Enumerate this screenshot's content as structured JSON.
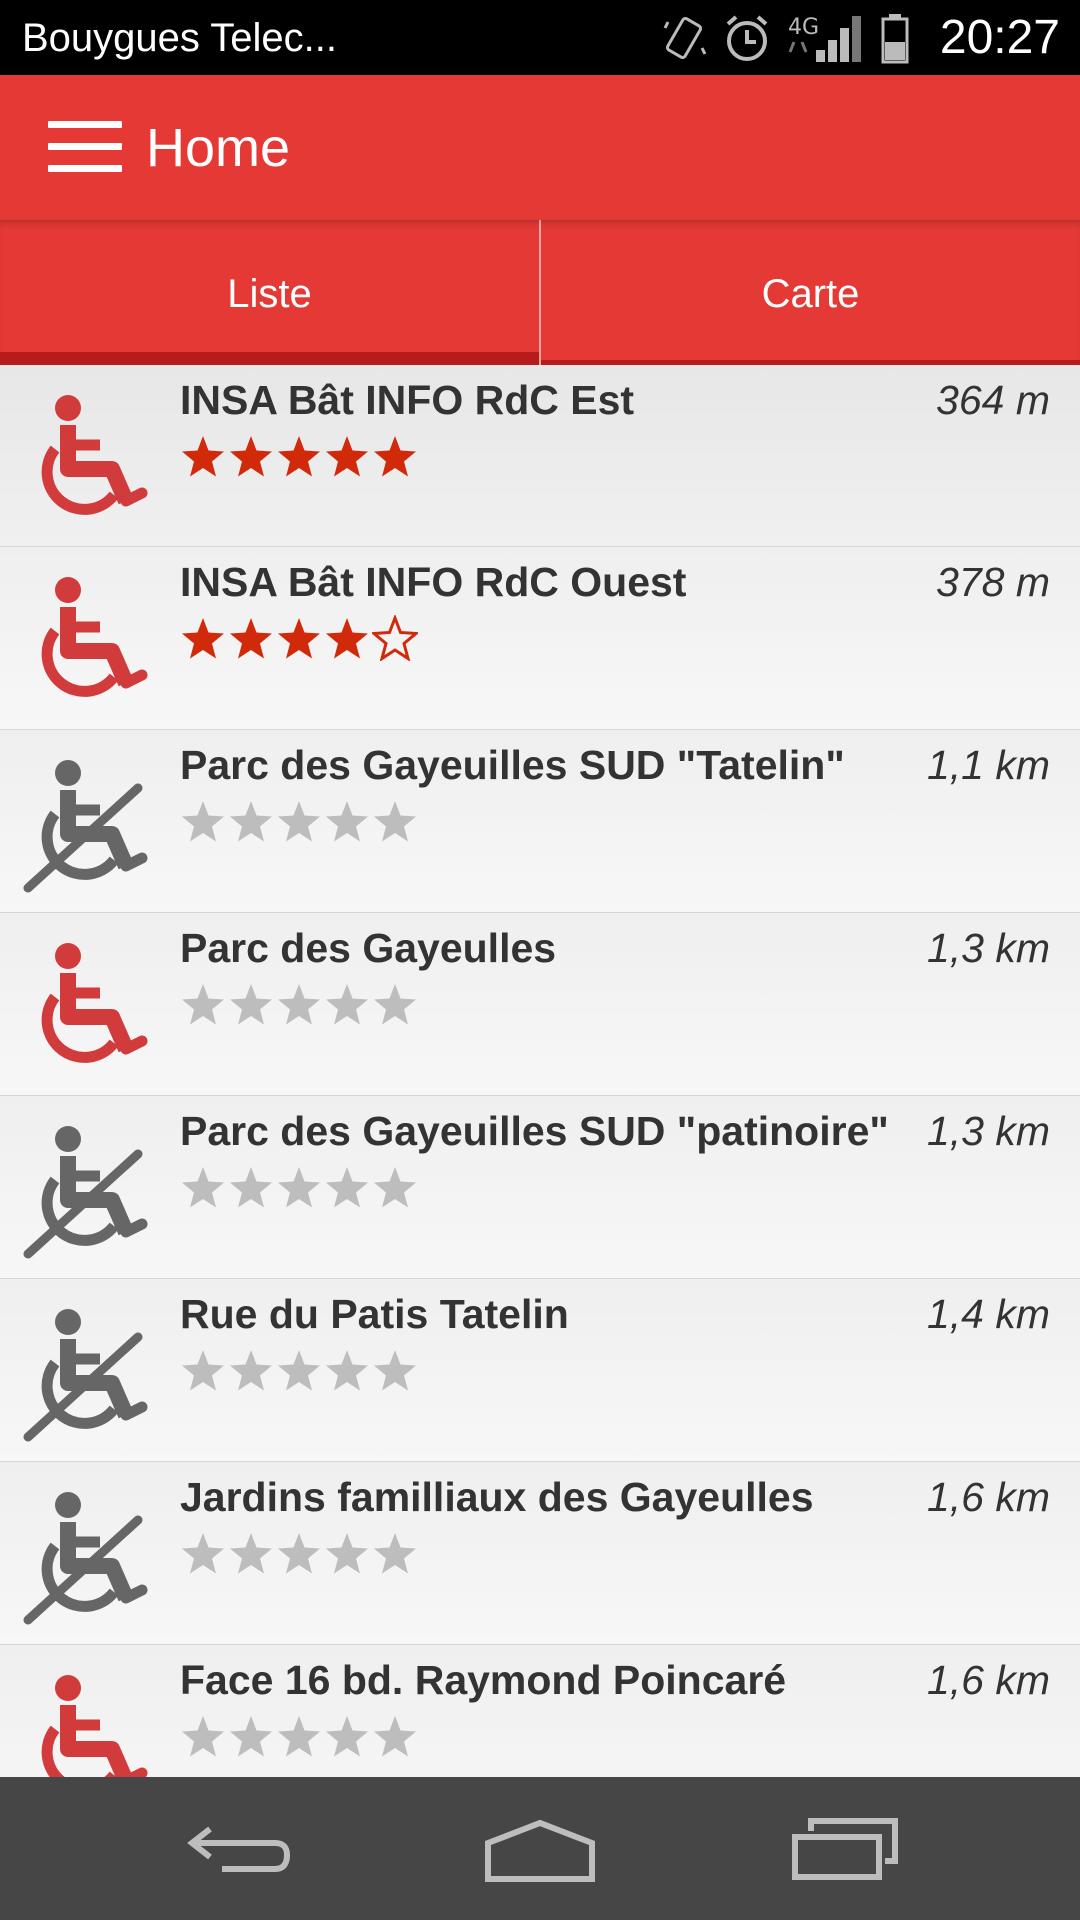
{
  "status_bar": {
    "carrier": "Bouygues Telec...",
    "network": "4G",
    "time": "20:27"
  },
  "app_bar": {
    "title": "Home",
    "menu_icon": "hamburger-menu-icon"
  },
  "tabs": [
    {
      "label": "Liste",
      "selected": true
    },
    {
      "label": "Carte",
      "selected": false
    }
  ],
  "places": [
    {
      "name": "INSA Bât INFO RdC Est",
      "distance": "364 m",
      "accessible": true,
      "rating": 5
    },
    {
      "name": "INSA Bât INFO RdC Ouest",
      "distance": "378 m",
      "accessible": true,
      "rating": 4
    },
    {
      "name": "Parc des Gayeuilles SUD \"Tatelin\"",
      "distance": "1,1 km",
      "accessible": false,
      "rating": 0
    },
    {
      "name": "Parc des Gayeulles",
      "distance": "1,3 km",
      "accessible": true,
      "rating": 0
    },
    {
      "name": "Parc des Gayeuilles SUD \"patinoire\"",
      "distance": "1,3 km",
      "accessible": false,
      "rating": 0
    },
    {
      "name": "Rue du Patis Tatelin",
      "distance": "1,4 km",
      "accessible": false,
      "rating": 0
    },
    {
      "name": "Jardins familliaux des Gayeulles",
      "distance": "1,6 km",
      "accessible": false,
      "rating": 0
    },
    {
      "name": "Face 16 bd. Raymond Poincaré",
      "distance": "1,6 km",
      "accessible": true,
      "rating": 0
    }
  ],
  "rating_max": 5,
  "colors": {
    "primary": "#e53935",
    "primary_dark": "#b71c1c",
    "accessible_icon": "#d13b3b",
    "inaccessible_icon": "#666666",
    "star_filled": "#d12a0b",
    "star_empty": "#bdbdbd",
    "nav_bar": "#464646"
  },
  "nav_buttons": [
    "back-icon",
    "home-icon",
    "recent-apps-icon"
  ]
}
